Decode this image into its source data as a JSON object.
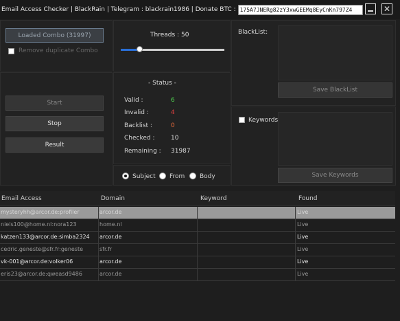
{
  "title": "Email Access Checker | BlackRain | Telegram : blackrain1986 | Donate BTC :",
  "btc_address": "175A7JNERg82zY3xwGEEMq8EyCnKn797Z4",
  "combo": {
    "loaded_label": "Loaded Combo (31997)",
    "remove_duplicate_label": "Remove duplicate Combo"
  },
  "threads": {
    "label": "Threads :",
    "value": "50",
    "slider_fraction": 0.18
  },
  "blacklist": {
    "label": "BlackList:",
    "save_label": "Save BlackList"
  },
  "keywords": {
    "label": "Keywords",
    "save_label": "Save Keywords"
  },
  "actions": {
    "start": "Start",
    "stop": "Stop",
    "result": "Result"
  },
  "status": {
    "title": "- Status -",
    "valid_label": "Valid :",
    "valid_value": "6",
    "invalid_label": "Invalid :",
    "invalid_value": "4",
    "backlist_label": "Backlist :",
    "backlist_value": "0",
    "checked_label": "Checked :",
    "checked_value": "10",
    "remaining_label": "Remaining :",
    "remaining_value": "31987"
  },
  "search_mode": {
    "subject": "Subject",
    "from": "From",
    "body": "Body",
    "selected": "subject"
  },
  "colors": {
    "valid": "#4fd04f",
    "invalid": "#e04040",
    "backlist": "#e86a3a",
    "accent": "#2a6fd8"
  },
  "table": {
    "columns": [
      "Email Access",
      "Domain",
      "Keyword",
      "Found"
    ],
    "rows": [
      {
        "email": "mysteryhh@arcor.de:profiler",
        "domain": "arcor.de",
        "keyword": "",
        "found": "Live"
      },
      {
        "email": "niels100@home.nl:nora123",
        "domain": "home.nl",
        "keyword": "",
        "found": "Live"
      },
      {
        "email": "katzen133@arcor.de:simba2324",
        "domain": "arcor.de",
        "keyword": "",
        "found": "Live"
      },
      {
        "email": "cedric.geneste@sfr.fr:geneste",
        "domain": "sfr.fr",
        "keyword": "",
        "found": "Live"
      },
      {
        "email": "vk-001@arcor.de:volker06",
        "domain": "arcor.de",
        "keyword": "",
        "found": "Live"
      },
      {
        "email": "eris23@arcor.de:qweasd9486",
        "domain": "arcor.de",
        "keyword": "",
        "found": "Live"
      }
    ]
  }
}
